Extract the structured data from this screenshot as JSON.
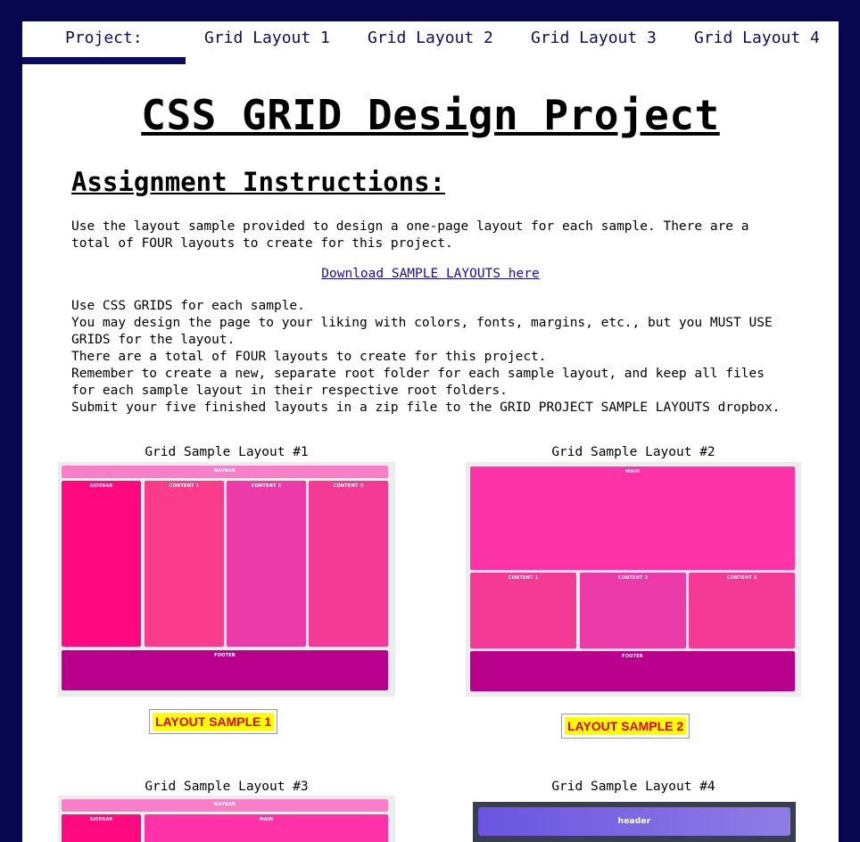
{
  "nav": {
    "brand": "Project:",
    "items": [
      "Grid Layout 1",
      "Grid Layout 2",
      "Grid Layout 3",
      "Grid Layout 4"
    ]
  },
  "main_title": "CSS GRID Design Project",
  "sub_title": "Assignment Instructions:",
  "intro": "Use the layout sample provided to design a one-page layout for each sample. There are a\ntotal of FOUR layouts to create for this project.",
  "download_link": "Download SAMPLE LAYOUTS here",
  "instructions": "Use CSS GRIDS for each sample.\nYou may design the page to your liking with colors, fonts, margins, etc., but you MUST USE\nGRIDS for the layout.\nThere are a total of FOUR layouts to create for this project.\nRemember to create a new, separate root folder for each sample layout, and keep all files\nfor each sample layout in their respective root folders.\nSubmit your five finished layouts in a zip file to the GRID PROJECT SAMPLE LAYOUTS dropbox.",
  "samples": [
    {
      "caption": "Grid Sample Layout #1",
      "badge": "LAYOUT SAMPLE 1",
      "labels": {
        "navbar": "NAVBAR",
        "sidebar": "SIDEBAR",
        "content1": "CONTENT 1",
        "content2": "CONTENT 2",
        "content3": "CONTENT 3",
        "footer": "FOOTER"
      }
    },
    {
      "caption": "Grid Sample Layout #2",
      "badge": "LAYOUT SAMPLE 2",
      "labels": {
        "main": "MAIN",
        "content1": "CONTENT 1",
        "content2": "CONTENT 2",
        "content3": "CONTENT 3",
        "footer": "FOOTER"
      }
    },
    {
      "caption": "Grid Sample Layout #3",
      "labels": {
        "navbar": "NAVBAR",
        "sidebar": "SIDEBAR",
        "main": "MAIN"
      }
    },
    {
      "caption": "Grid Sample Layout #4",
      "labels": {
        "header": "header"
      }
    }
  ],
  "colors": {
    "frame": "#07064f",
    "nav_text": "#0b0b63",
    "link": "#1a0dab",
    "pink_light": "#f77fc8",
    "pink_hot": "#ff0a7e",
    "pink_mid": "#fb3c8c",
    "pink_magenta": "#ec3aa8",
    "pink_rose": "#f43a95",
    "purple_footer": "#b8008c",
    "header_purple": "#6e5ee0",
    "badge_yellow": "#ffff00",
    "badge_red": "#e0001b"
  }
}
